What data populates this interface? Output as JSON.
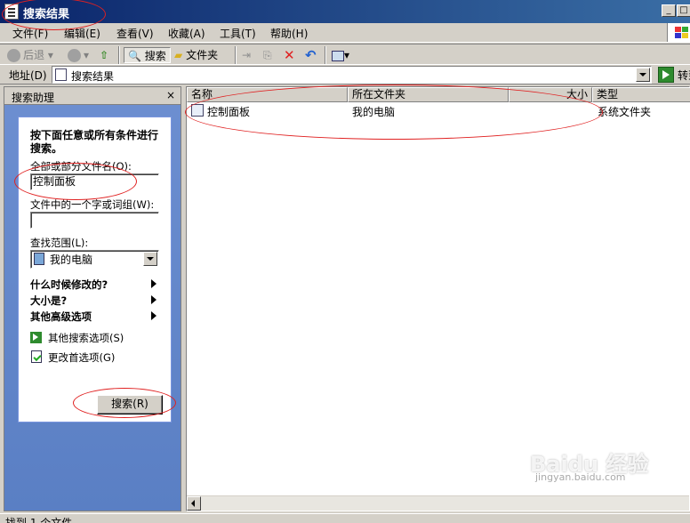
{
  "window": {
    "title": "搜索结果"
  },
  "menu": [
    "文件(F)",
    "编辑(E)",
    "查看(V)",
    "收藏(A)",
    "工具(T)",
    "帮助(H)"
  ],
  "toolbar": {
    "back": "后退",
    "search": "搜索",
    "folders": "文件夹"
  },
  "address": {
    "label": "地址(D)",
    "value": "搜索结果",
    "go": "转到"
  },
  "left_pane": {
    "title": "搜索助理",
    "instruction": "按下面任意或所有条件进行搜索。",
    "filename_label": "全部或部分文件名(O):",
    "filename_value": "控制面板",
    "phrase_label": "文件中的一个字或词组(W):",
    "phrase_value": "",
    "scope_label": "查找范围(L):",
    "scope_value": "我的电脑",
    "when_modified": "什么时候修改的?",
    "size": "大小是?",
    "advanced": "其他高级选项",
    "other_options": "其他搜索选项(S)",
    "change_prefs": "更改首选项(G)",
    "search_button": "搜索(R)"
  },
  "results": {
    "columns": [
      "名称",
      "所在文件夹",
      "大小",
      "类型"
    ],
    "rows": [
      {
        "name": "控制面板",
        "folder": "我的电脑",
        "size": "",
        "type": "系统文件夹"
      }
    ]
  },
  "status": {
    "text": "找到 1 个文件"
  },
  "watermark": {
    "brand": "Baidu 经验",
    "url": "jingyan.baidu.com"
  },
  "colors": {
    "title_bar": "#0a246a",
    "pane_blue": "#6c8ed0",
    "annotation_red": "#e02020"
  }
}
